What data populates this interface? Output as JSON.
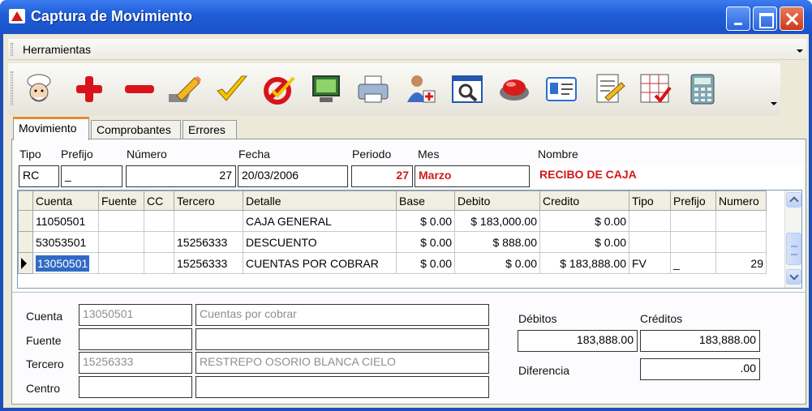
{
  "window": {
    "title": "Captura de Movimiento"
  },
  "menu": {
    "herramientas": "Herramientas"
  },
  "toolbar": {
    "icons": [
      "chef-icon",
      "add-icon",
      "remove-icon",
      "edit-pencil-icon",
      "checkmark-icon",
      "cancel-check-icon",
      "monitor-icon",
      "printer-icon",
      "user-add-icon",
      "search-window-icon",
      "record-button-icon",
      "id-card-icon",
      "document-edit-icon",
      "grid-check-icon",
      "calculator-icon"
    ]
  },
  "tabs": [
    "Movimiento",
    "Comprobantes",
    "Errores"
  ],
  "header": {
    "labels": {
      "tipo": "Tipo",
      "prefijo": "Prefijo",
      "numero": "Número",
      "fecha": "Fecha",
      "periodo": "Periodo",
      "mes": "Mes",
      "nombre": "Nombre"
    },
    "values": {
      "tipo": "RC",
      "prefijo": "_",
      "numero": "27",
      "fecha": "20/03/2006",
      "periodo": "27",
      "mes": "Marzo",
      "nombre": "RECIBO DE CAJA"
    }
  },
  "grid": {
    "columns": [
      "Cuenta",
      "Fuente",
      "CC",
      "Tercero",
      "Detalle",
      "Base",
      "Debito",
      "Credito",
      "Tipo",
      "Prefijo",
      "Numero"
    ],
    "rows": [
      [
        "11050501",
        "",
        "",
        "",
        "CAJA GENERAL",
        "$ 0.00",
        "$ 183,000.00",
        "$ 0.00",
        "",
        "",
        ""
      ],
      [
        "53053501",
        "",
        "",
        "15256333",
        "DESCUENTO",
        "$ 0.00",
        "$ 888.00",
        "$ 0.00",
        "",
        "",
        ""
      ],
      [
        "13050501",
        "",
        "",
        "15256333",
        "CUENTAS POR COBRAR",
        "$ 0.00",
        "$ 0.00",
        "$ 183,888.00",
        "FV",
        "_",
        "29"
      ]
    ]
  },
  "detail": {
    "labels": {
      "cuenta": "Cuenta",
      "fuente": "Fuente",
      "tercero": "Tercero",
      "centro": "Centro"
    },
    "values": {
      "cuenta_code": "13050501",
      "cuenta_name": "Cuentas por cobrar",
      "fuente_code": "",
      "fuente_name": "",
      "tercero_code": "15256333",
      "tercero_name": "RESTREPO OSORIO BLANCA CIELO",
      "centro_code": "",
      "centro_name": ""
    }
  },
  "totals": {
    "labels": {
      "debitos": "Débitos",
      "creditos": "Créditos",
      "diferencia": "Diferencia"
    },
    "values": {
      "debitos": "183,888.00",
      "creditos": "183,888.00",
      "diferencia": ".00"
    }
  }
}
